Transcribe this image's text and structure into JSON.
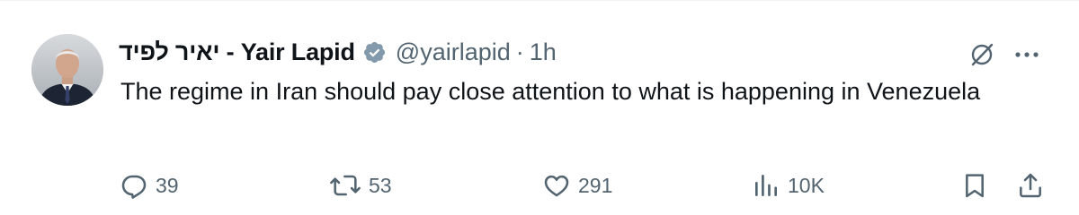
{
  "tweet": {
    "author": {
      "display_name": "יאיר לפיד - Yair Lapid",
      "handle": "@yairlapid",
      "verified": true
    },
    "separator": "·",
    "time": "1h",
    "text": "The regime in Iran should pay close attention to what is happening in Venezuela"
  },
  "actions": {
    "reply": {
      "icon": "reply-icon",
      "count": "39"
    },
    "retweet": {
      "icon": "retweet-icon",
      "count": "53"
    },
    "like": {
      "icon": "heart-icon",
      "count": "291"
    },
    "views": {
      "icon": "views-icon",
      "count": "10K"
    },
    "bookmark": {
      "icon": "bookmark-icon"
    },
    "share": {
      "icon": "share-icon"
    }
  },
  "colors": {
    "text_primary": "#0f1419",
    "text_secondary": "#536471",
    "verified_badge": "#829aab"
  }
}
